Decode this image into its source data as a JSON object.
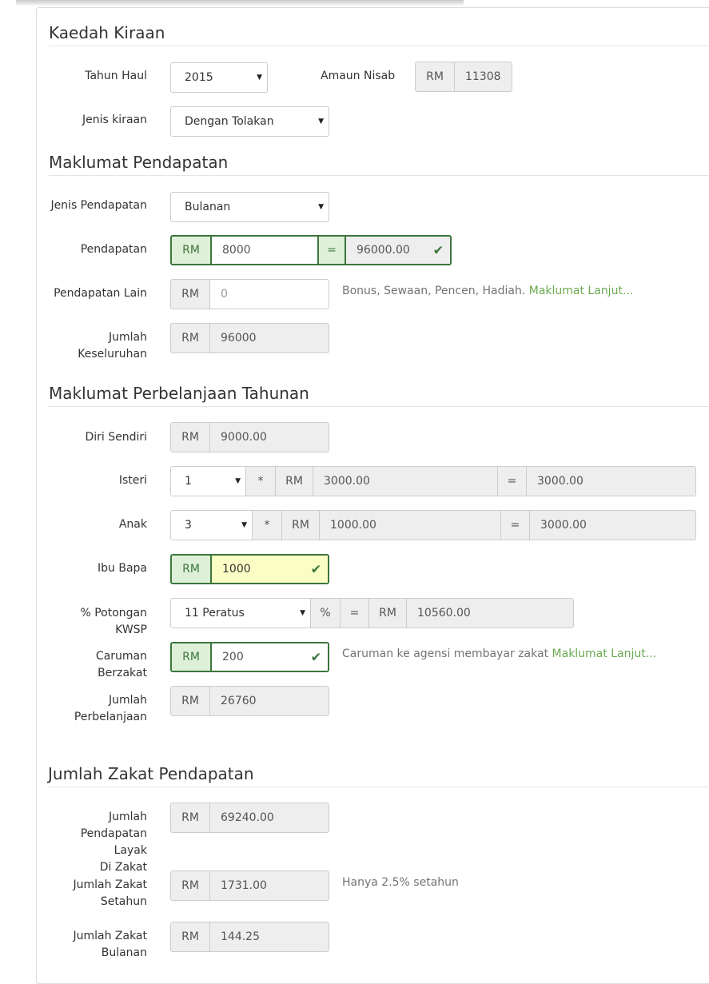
{
  "sections": {
    "kaedah": "Kaedah Kiraan",
    "pendapatan": "Maklumat Pendapatan",
    "perbelanjaan": "Maklumat Perbelanjaan Tahunan",
    "zakat": "Jumlah Zakat Pendapatan"
  },
  "currency": "RM",
  "kaedah": {
    "tahun_haul_label": "Tahun Haul",
    "tahun_haul_value": "2015",
    "amaun_nisab_label": "Amaun Nisab",
    "amaun_nisab_value": "11308",
    "jenis_kiraan_label": "Jenis kiraan",
    "jenis_kiraan_value": "Dengan Tolakan"
  },
  "pendapatan": {
    "jenis_label": "Jenis Pendapatan",
    "jenis_value": "Bulanan",
    "pendapatan_label": "Pendapatan",
    "pendapatan_value": "8000",
    "equals": "=",
    "pendapatan_total": "96000.00",
    "lain_label": "Pendapatan Lain",
    "lain_placeholder": "0",
    "lain_help": "Bonus, Sewaan, Pencen, Hadiah.",
    "lain_link": "Maklumat Lanjut...",
    "jumlah_label_1": "Jumlah",
    "jumlah_label_2": "Keseluruhan",
    "jumlah_value": "96000"
  },
  "perbelanjaan": {
    "diri_label": "Diri Sendiri",
    "diri_value": "9000.00",
    "isteri_label": "Isteri",
    "isteri_count": "1",
    "times": "*",
    "isteri_rate": "3000.00",
    "equals": "=",
    "isteri_total": "3000.00",
    "anak_label": "Anak",
    "anak_count": "3",
    "anak_rate": "1000.00",
    "anak_total": "3000.00",
    "ibubapa_label": "Ibu Bapa",
    "ibubapa_value": "1000",
    "kwsp_label": "% Potongan KWSP",
    "kwsp_value": "11 Peratus",
    "percent": "%",
    "kwsp_total": "10560.00",
    "caruman_label": "Caruman Berzakat",
    "caruman_value": "200",
    "caruman_help": "Caruman ke agensi membayar zakat",
    "caruman_link": "Maklumat Lanjut...",
    "jumlah_label_1": "Jumlah",
    "jumlah_label_2": "Perbelanjaan",
    "jumlah_value": "26760"
  },
  "zakat": {
    "layak_label_1": "Jumlah",
    "layak_label_2": "Pendapatan Layak",
    "layak_label_3": "Di Zakat",
    "layak_value": "69240.00",
    "setahun_label_1": "Jumlah Zakat",
    "setahun_label_2": "Setahun",
    "setahun_value": "1731.00",
    "setahun_help": "Hanya 2.5% setahun",
    "bulanan_label_1": "Jumlah Zakat",
    "bulanan_label_2": "Bulanan",
    "bulanan_value": "144.25"
  }
}
